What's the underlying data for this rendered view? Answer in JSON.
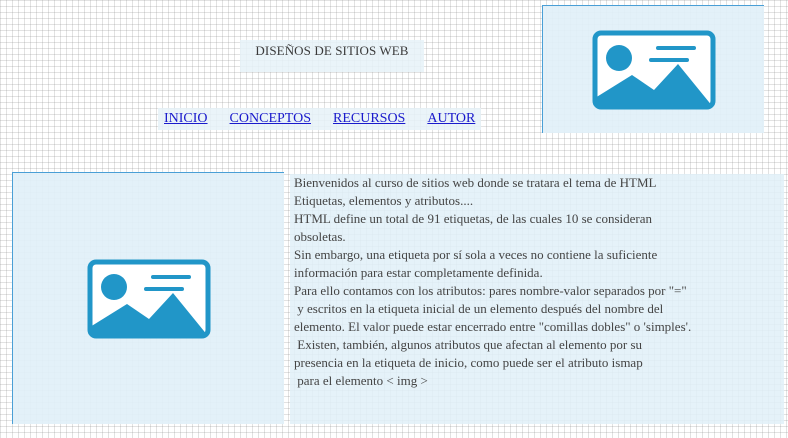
{
  "header": {
    "title": "DISEÑOS DE SITIOS WEB"
  },
  "nav": {
    "items": [
      "INICIO",
      "CONCEPTOS",
      "RECURSOS",
      "AUTOR"
    ]
  },
  "content": {
    "lines": [
      "Bienvenidos al curso de sitios web donde se tratara el tema de HTML",
      "Etiquetas, elementos y atributos....",
      "HTML define un total de 91 etiquetas, de las cuales 10 se consideran",
      "obsoletas.",
      "Sin embargo, una etiqueta por sí sola a veces no contiene la suficiente",
      "información para estar completamente definida.",
      "Para ello contamos con los atributos: pares nombre-valor separados por \"=\"",
      " y escritos en la etiqueta inicial de un elemento después del nombre del",
      "elemento. El valor puede estar encerrado entre \"comillas dobles\" o 'simples'.",
      " Existen, también, algunos atributos que afectan al elemento por su",
      "presencia en la etiqueta de inicio, como puede ser el atributo ismap",
      " para el elemento < img >"
    ]
  },
  "images": {
    "top": {
      "icon": "image-placeholder-icon"
    },
    "main": {
      "icon": "image-placeholder-icon"
    }
  },
  "colors": {
    "accent": "#2196c8",
    "placeholder_bg": "#e1f0f8",
    "link": "#1a1acc"
  }
}
